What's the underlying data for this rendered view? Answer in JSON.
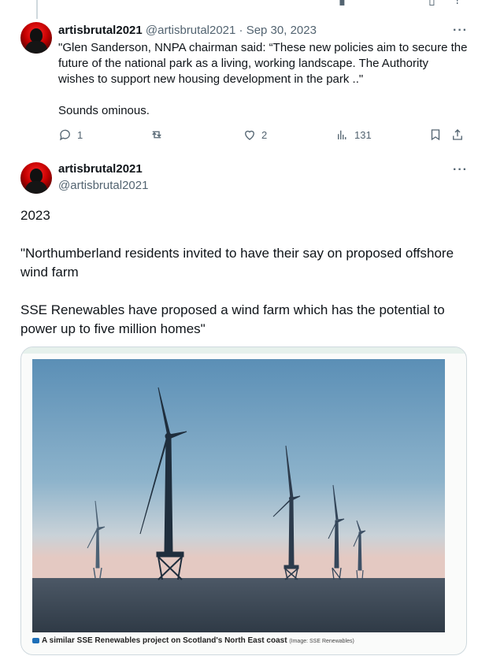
{
  "tweet1": {
    "display_name": "artisbrutal2021",
    "handle_date": "@artisbrutal2021 · Sep 30, 2023",
    "text_p1": "\"Glen Sanderson, NNPA chairman said: “These new policies aim to secure the future of the national park as a living, working landscape. The Authority wishes to support new housing development in the park ..\"",
    "text_p2": "Sounds ominous.",
    "more_label": "···",
    "reply_count": "1",
    "like_count": "2",
    "view_count": "131"
  },
  "tweet2": {
    "display_name": "artisbrutal2021",
    "handle": "@artisbrutal2021",
    "more_label": "···",
    "text_p1": "2023",
    "text_p2": "\"Northumberland residents invited to have their say on proposed offshore wind farm",
    "text_p3": "SSE Renewables have proposed a wind farm which has the potential to power up to five million homes\"",
    "media": {
      "caption": "A similar SSE Renewables project on Scotland's North East coast",
      "credit": "(Image: SSE Renewables)"
    }
  },
  "colors": {
    "text": "#0f1419",
    "secondary": "#536471",
    "border": "#cfd9de",
    "sky_top": "#5d90b6",
    "sea": "#3e4a58"
  },
  "icons": [
    "reply-icon",
    "retweet-icon",
    "like-icon",
    "views-icon",
    "bookmark-icon",
    "share-icon",
    "more-icon"
  ]
}
